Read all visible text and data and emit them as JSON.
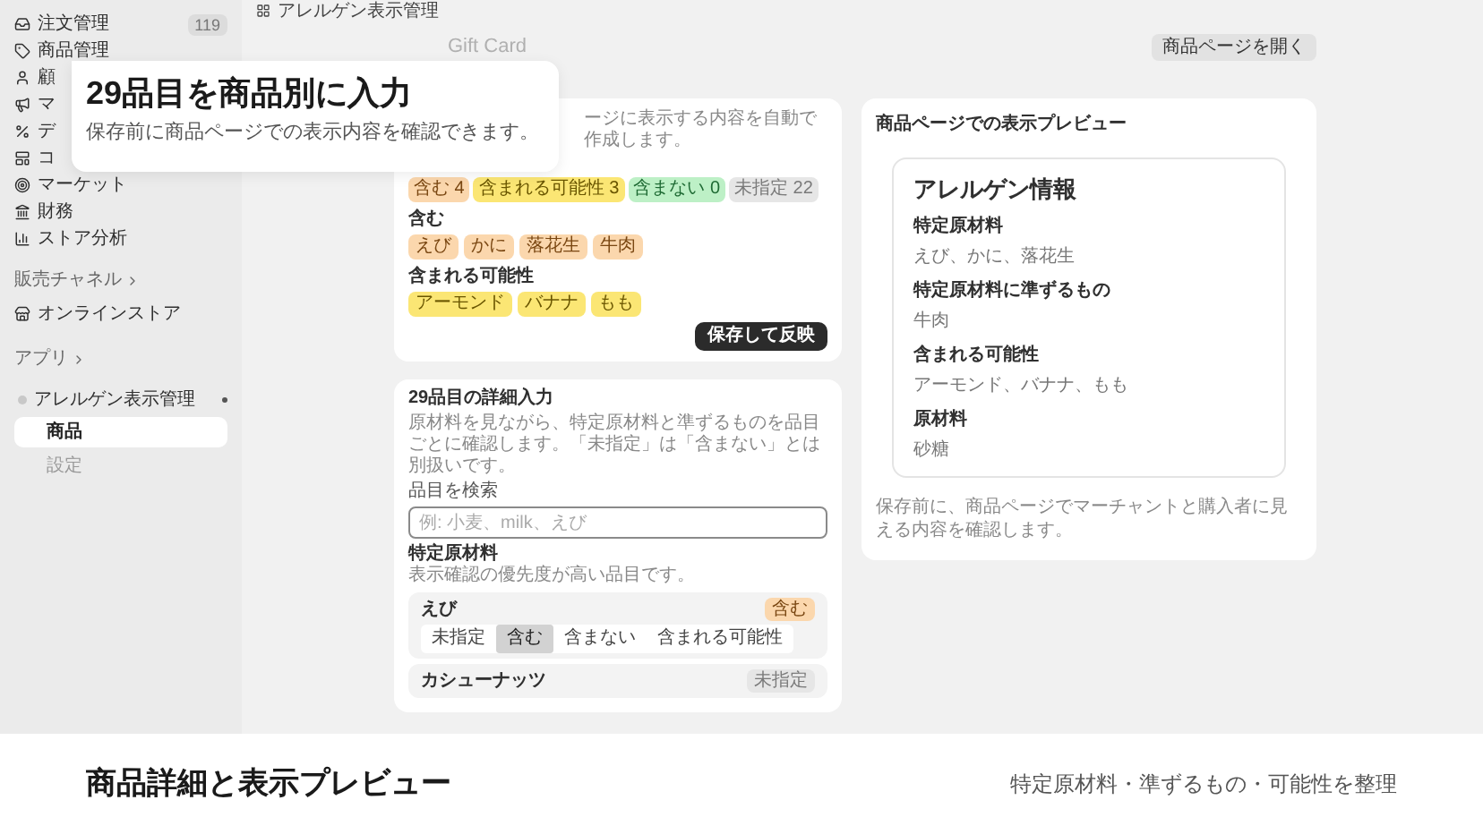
{
  "breadcrumb": "アレルゲン表示管理",
  "sidebar": {
    "items": [
      {
        "label": "注文管理",
        "count": "119"
      },
      {
        "label": "商品管理"
      },
      {
        "label": "顧"
      },
      {
        "label": "マ"
      },
      {
        "label": "デ"
      },
      {
        "label": "コ"
      },
      {
        "label": "マーケット"
      },
      {
        "label": "財務"
      },
      {
        "label": "ストア分析"
      }
    ],
    "channels_heading": "販売チャネル",
    "channels": [
      {
        "label": "オンラインストア"
      }
    ],
    "apps_heading": "アプリ",
    "app": {
      "label": "アレルゲン表示管理",
      "children": [
        {
          "label": "商品",
          "selected": true
        },
        {
          "label": "設定",
          "selected": false
        }
      ]
    }
  },
  "callout": {
    "title": "29品目を商品別に入力",
    "subtitle": "保存前に商品ページでの表示内容を確認できます。"
  },
  "page_title": "Gift Card",
  "open_button": "商品ページを開く",
  "summary_card": {
    "description": "ージに表示する内容を自動で作成します。",
    "counts": [
      {
        "label": "含む 4",
        "kind": "contains"
      },
      {
        "label": "含まれる可能性 3",
        "kind": "may_contain"
      },
      {
        "label": "含まない 0",
        "kind": "free"
      },
      {
        "label": "未指定 22",
        "kind": "unset"
      }
    ],
    "groups": [
      {
        "heading": "含む",
        "kind": "contains",
        "chips": [
          "えび",
          "かに",
          "落花生",
          "牛肉"
        ]
      },
      {
        "heading": "含まれる可能性",
        "kind": "may_contain",
        "chips": [
          "アーモンド",
          "バナナ",
          "もも"
        ]
      }
    ],
    "save_button": "保存して反映"
  },
  "detail_card": {
    "title": "29品目の詳細入力",
    "description": "原材料を見ながら、特定原材料と準ずるものを品目ごとに確認します。「未指定」は「含まない」とは別扱いです。",
    "search_label": "品目を検索",
    "search_placeholder": "例: 小麦、milk、えび",
    "section_title": "特定原材料",
    "section_note": "表示確認の優先度が高い品目です。",
    "items": [
      {
        "name": "えび",
        "status": "含む",
        "kind": "contains",
        "options": [
          {
            "label": "未指定",
            "selected": false
          },
          {
            "label": "含む",
            "selected": true
          },
          {
            "label": "含まない",
            "selected": false
          },
          {
            "label": "含まれる可能性",
            "selected": false
          }
        ]
      },
      {
        "name": "カシューナッツ",
        "status": "未指定",
        "kind": "unset"
      }
    ]
  },
  "preview_card": {
    "title": "商品ページでの表示プレビュー",
    "heading": "アレルゲン情報",
    "sections": [
      {
        "label": "特定原材料",
        "value": "えび、かに、落花生"
      },
      {
        "label": "特定原材料に準ずるもの",
        "value": "牛肉"
      },
      {
        "label": "含まれる可能性",
        "value": "アーモンド、バナナ、もも"
      },
      {
        "label": "原材料",
        "value": "砂糖"
      }
    ],
    "note": "保存前に、商品ページでマーチャントと購入者に見える内容を確認します。"
  },
  "caption": {
    "title": "商品詳細と表示プレビュー",
    "subtitle": "特定原材料・準ずるもの・可能性を整理"
  }
}
